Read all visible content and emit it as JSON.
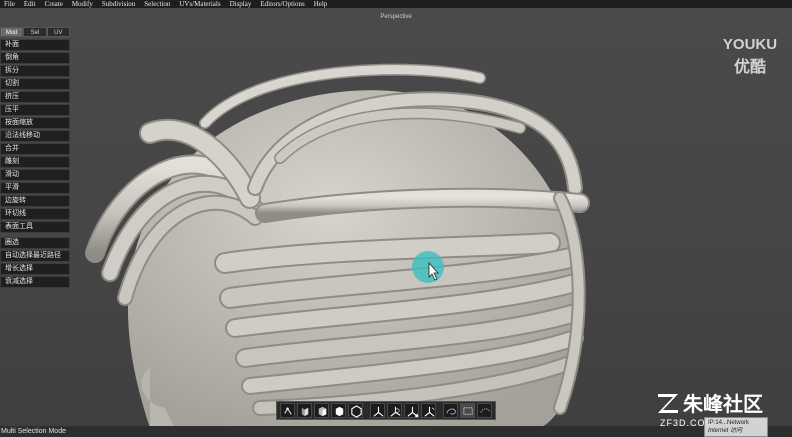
{
  "menubar": {
    "items": [
      "File",
      "Edit",
      "Create",
      "Modify",
      "Subdivision",
      "Selection",
      "UVs/Materials",
      "Display",
      "Editors/Options",
      "Help"
    ]
  },
  "viewport": {
    "label": "Perspective"
  },
  "watermark": {
    "brand_en": "YOUKU",
    "brand_cn": "优酷"
  },
  "panel": {
    "tabs": [
      {
        "label": "Mod",
        "active": true
      },
      {
        "label": "Sel",
        "active": false
      },
      {
        "label": "UV",
        "active": false
      }
    ],
    "tools": [
      "补面",
      "倒角",
      "拆分",
      "切割",
      "挤压",
      "压平",
      "按面缩放",
      "沿法线移动",
      "合并",
      "雕刻",
      "滑动",
      "平滑",
      "边旋转",
      "环切线",
      "表面工具"
    ],
    "select_tools": [
      "圈选",
      "自动选择最近路径",
      "增长选择",
      "衰减选择"
    ]
  },
  "bottom_toolbar": {
    "icons": [
      "vertex-mode-icon",
      "edge-mode-icon",
      "face-mode-icon",
      "object-mode-icon",
      "mesh-mode-icon",
      "move-axis-icon",
      "rotate-axis-icon",
      "scale-axis-icon",
      "universal-axis-icon",
      "lasso-select-icon",
      "rect-select-icon",
      "paint-select-icon"
    ]
  },
  "status": {
    "text": "Multi Selection Mode"
  },
  "community": {
    "name": "朱峰社区",
    "url": "ZF3D.COM"
  },
  "tooltip": {
    "line1": "IP:14...Network",
    "line2": "Internet 访问"
  },
  "colors": {
    "model": "#c8c6bf",
    "cursor_highlight": "#3bbfc0"
  }
}
